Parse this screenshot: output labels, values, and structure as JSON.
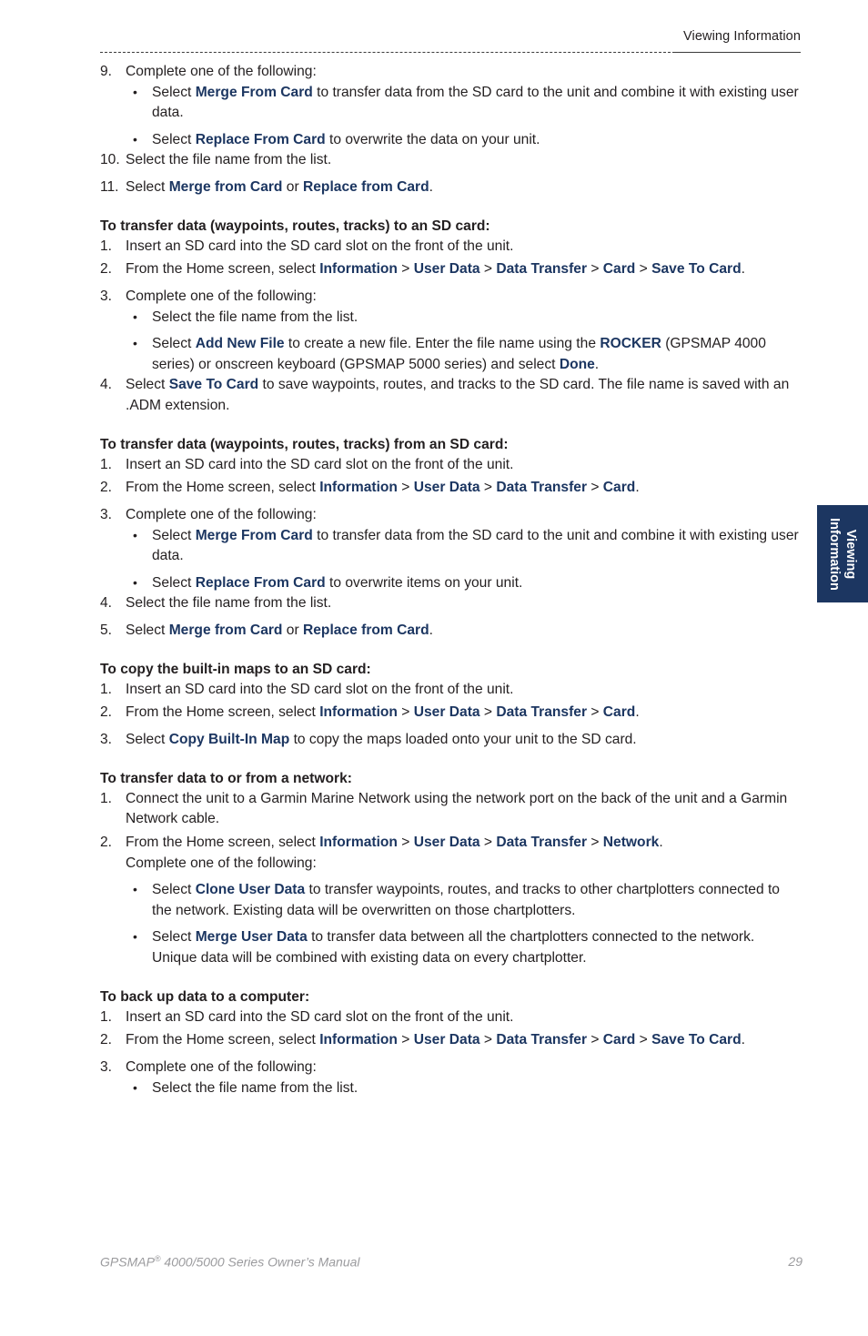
{
  "header": {
    "title": "Viewing Information"
  },
  "side_tab": {
    "line1": "Viewing",
    "line2": "Information",
    "background_color": "#1c3661",
    "text_color": "#ffffff"
  },
  "accent_color": "#1c3661",
  "body_text_color": "#231f20",
  "footer": {
    "manual_title_prefix": "GPSMAP",
    "registered_mark": "®",
    "manual_title_suffix": " 4000/5000 Series Owner’s Manual",
    "page_number": "29"
  },
  "continued_steps": {
    "step9": {
      "num": "9.",
      "text": "Complete one of the following:"
    },
    "step9_bullets": [
      {
        "pre": "Select ",
        "kw": "Merge From Card",
        "post": " to transfer data from the SD card to the unit and combine it with existing user data."
      },
      {
        "pre": "Select ",
        "kw": "Replace From Card",
        "post": " to overwrite the data on your unit."
      }
    ],
    "step10": {
      "num": "10.",
      "text": "Select the file name from the list."
    },
    "step11": {
      "num": "11.",
      "pre": "Select ",
      "kw1": "Merge from Card",
      "mid": " or ",
      "kw2": "Replace from Card",
      "post": "."
    }
  },
  "sections": [
    {
      "heading": "To transfer data (waypoints, routes, tracks) to an SD card:",
      "steps": [
        {
          "num": "1.",
          "text": "Insert an SD card into the SD card slot on the front of the unit."
        },
        {
          "num": "2.",
          "pre": "From the Home screen, select ",
          "path": [
            "Information",
            "User Data",
            "Data Transfer",
            "Card",
            "Save To Card"
          ],
          "post": "."
        },
        {
          "num": "3.",
          "text": "Complete one of the following:"
        }
      ],
      "bullets": [
        {
          "pre": "Select the file name from the list.",
          "kw": "",
          "post": ""
        },
        {
          "pre": "Select ",
          "kw": "Add New File",
          "mid1": " to create a new file. Enter the file name using the ",
          "kw2": "ROCKER",
          "mid2": " (GPSMAP 4000 series) or onscreen keyboard (GPSMAP 5000 series) and select ",
          "kw3": "Done",
          "post": "."
        }
      ],
      "steps_after": [
        {
          "num": "4.",
          "pre": "Select ",
          "kw": "Save To Card",
          "post": " to save waypoints, routes, and tracks to the SD card. The file name is saved with an .ADM extension."
        }
      ]
    },
    {
      "heading": "To transfer data (waypoints, routes, tracks) from an SD card:",
      "steps": [
        {
          "num": "1.",
          "text": "Insert an SD card into the SD card slot on the front of the unit."
        },
        {
          "num": "2.",
          "pre": "From the Home screen, select ",
          "path": [
            "Information",
            "User Data",
            "Data Transfer",
            "Card"
          ],
          "post": "."
        },
        {
          "num": "3.",
          "text": "Complete one of the following:"
        }
      ],
      "bullets": [
        {
          "pre": "Select ",
          "kw": "Merge From Card",
          "post": " to transfer data from the SD card to the unit and combine it with existing user data."
        },
        {
          "pre": "Select ",
          "kw": "Replace From Card",
          "post": " to overwrite items on your unit."
        }
      ],
      "steps_after": [
        {
          "num": "4.",
          "text": "Select the file name from the list."
        },
        {
          "num": "5.",
          "pre": "Select ",
          "kw1": "Merge from Card",
          "mid": " or ",
          "kw2": "Replace from Card",
          "post": "."
        }
      ]
    },
    {
      "heading": "To copy the built-in maps to an SD card:",
      "steps": [
        {
          "num": "1.",
          "text": "Insert an SD card into the SD card slot on the front of the unit."
        },
        {
          "num": "2.",
          "pre": "From the Home screen, select ",
          "path": [
            "Information",
            "User Data",
            "Data Transfer",
            "Card"
          ],
          "post": "."
        },
        {
          "num": "3.",
          "pre": "Select ",
          "kw": "Copy Built-In Map",
          "post": " to copy the maps loaded onto your unit to the SD card."
        }
      ]
    },
    {
      "heading": "To transfer data to or from a network:",
      "steps": [
        {
          "num": "1.",
          "text": "Connect the unit to a Garmin Marine Network using the network port on the back of the unit and a Garmin Network cable."
        },
        {
          "num": "2.",
          "pre": "From the Home screen, select ",
          "path": [
            "Information",
            "User Data",
            "Data Transfer",
            "Network"
          ],
          "post": "."
        }
      ],
      "plain_line": "Complete one of the following:",
      "bullets": [
        {
          "pre": "Select ",
          "kw": "Clone User Data",
          "post": " to transfer waypoints, routes, and tracks to other chartplotters connected to the network. Existing data will be overwritten on those chartplotters."
        },
        {
          "pre": "Select ",
          "kw": "Merge User Data",
          "post": " to transfer data between all the chartplotters connected to the network. Unique data will be combined with existing data on every chartplotter."
        }
      ]
    },
    {
      "heading": "To back up data to a computer:",
      "steps": [
        {
          "num": "1.",
          "text": "Insert an SD card into the SD card slot on the front of the unit."
        },
        {
          "num": "2.",
          "pre": "From the Home screen, select ",
          "path": [
            "Information",
            "User Data",
            "Data Transfer",
            "Card",
            "Save To Card"
          ],
          "post": "."
        },
        {
          "num": "3.",
          "text": "Complete one of the following:"
        }
      ],
      "bullets": [
        {
          "pre": "Select the file name from the list.",
          "kw": "",
          "post": ""
        }
      ]
    }
  ]
}
